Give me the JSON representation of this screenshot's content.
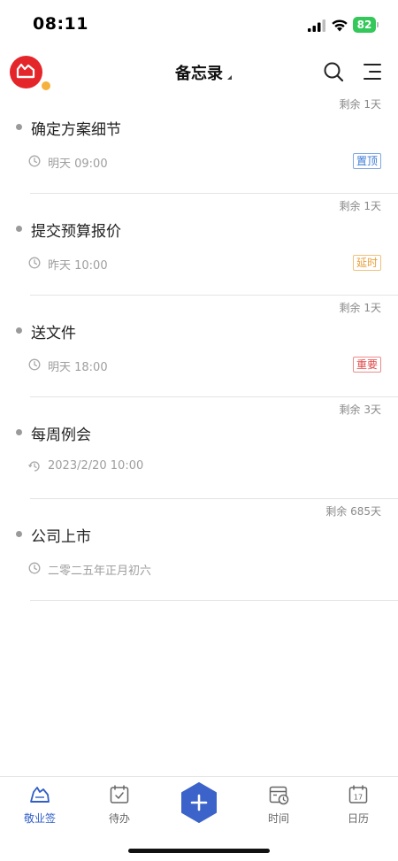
{
  "status_bar": {
    "time": "08:11",
    "battery": "82"
  },
  "header": {
    "title": "备忘录"
  },
  "memos": [
    {
      "remaining": "剩余 1天",
      "title": "确定方案细节",
      "time": "明天 09:00",
      "tag": "置顶",
      "tag_type": "pin",
      "time_icon": "clock-icon"
    },
    {
      "remaining": "剩余 1天",
      "title": "提交预算报价",
      "time": "昨天 10:00",
      "tag": "延时",
      "tag_type": "delay",
      "time_icon": "clock-icon"
    },
    {
      "remaining": "剩余 1天",
      "title": "送文件",
      "time": "明天 18:00",
      "tag": "重要",
      "tag_type": "important",
      "time_icon": "clock-icon"
    },
    {
      "remaining": "剩余 3天",
      "title": "每周例会",
      "time": "2023/2/20 10:00",
      "tag": "",
      "tag_type": "",
      "time_icon": "repeat-clock-icon"
    },
    {
      "remaining": "剩余 685天",
      "title": "公司上市",
      "time": "二零二五年正月初六",
      "tag": "",
      "tag_type": "",
      "time_icon": "clock-icon"
    }
  ],
  "tabs": [
    {
      "label": "敬业签",
      "icon": "app-logo-icon",
      "active": true
    },
    {
      "label": "待办",
      "icon": "todo-calendar-icon",
      "active": false
    },
    {
      "label": "",
      "icon": "plus-icon",
      "active": false
    },
    {
      "label": "时间",
      "icon": "time-management-icon",
      "active": false
    },
    {
      "label": "日历",
      "icon": "calendar-icon",
      "active": false
    }
  ],
  "calendar_icon_day": "17",
  "colors": {
    "accent": "#2f5ec8",
    "tag_pin": "#3a7bd5",
    "tag_delay": "#e8a03b",
    "tag_important": "#e04848",
    "battery": "#34c759",
    "avatar": "#e4262b"
  }
}
